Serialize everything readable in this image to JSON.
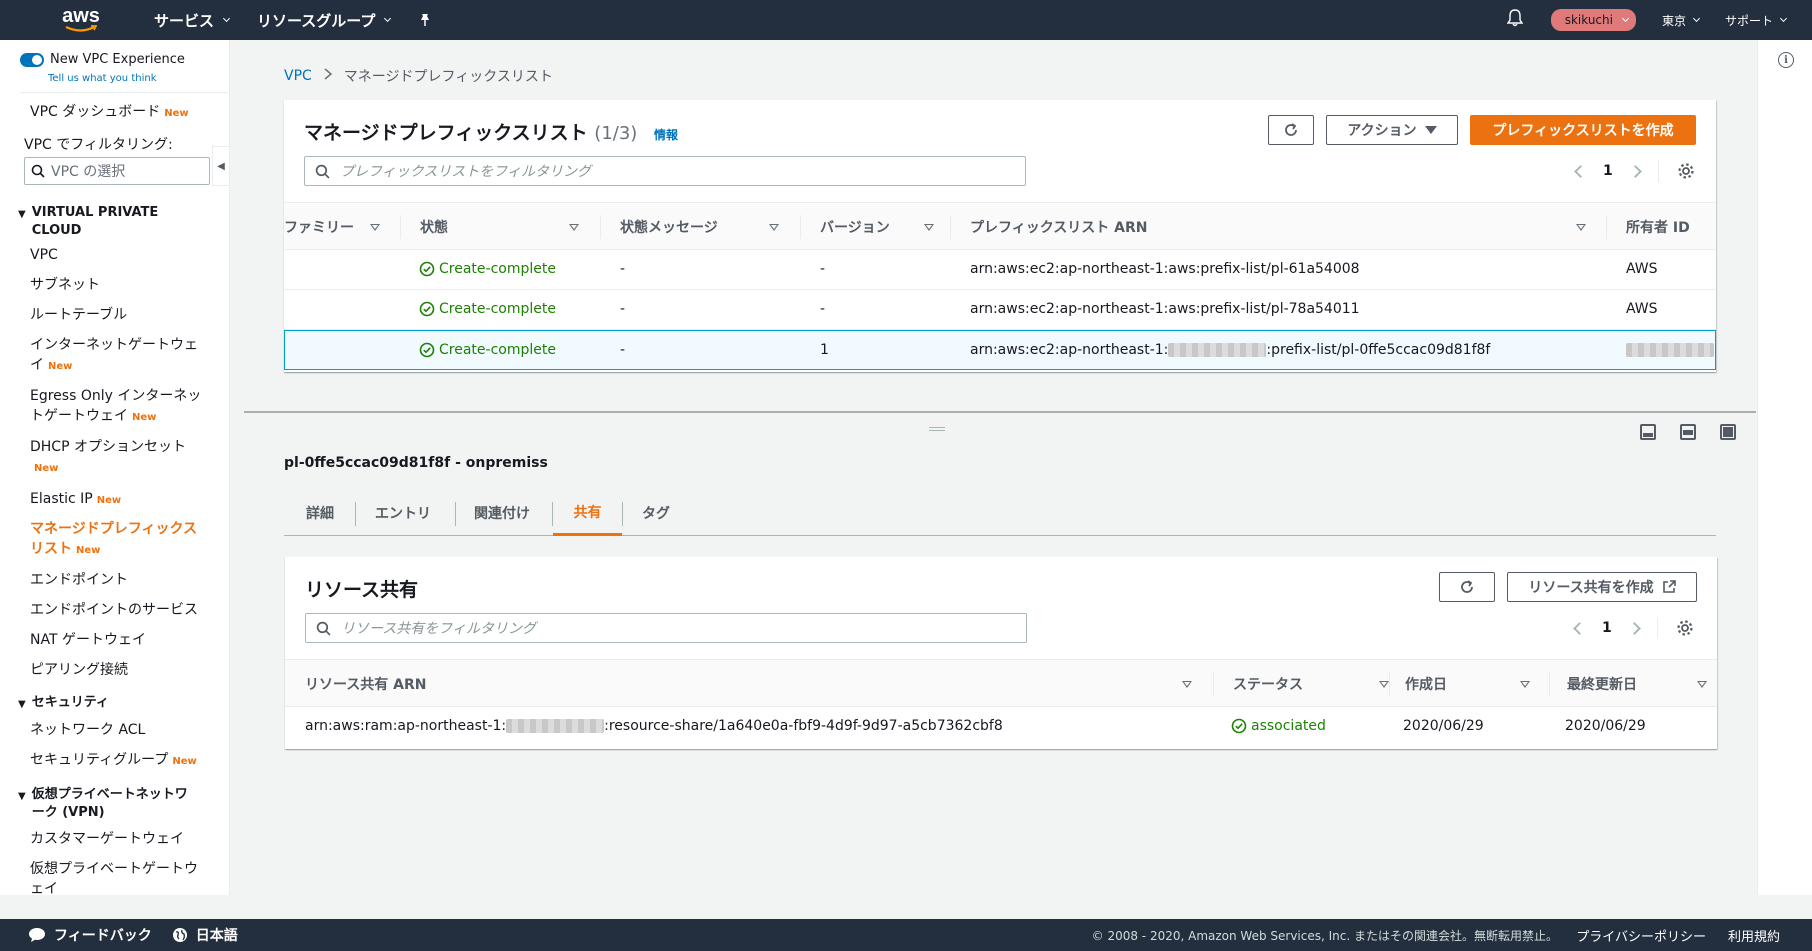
{
  "topnav": {
    "logo_text": "aws",
    "services": "サービス",
    "resource_groups": "リソースグループ",
    "user": "skikuchi",
    "region": "東京",
    "support": "サポート"
  },
  "sidebar": {
    "new_experience": "New VPC Experience",
    "feedback_link": "Tell us what you think",
    "dashboard": "VPC ダッシュボード",
    "new_badge": "New",
    "filter_label": "VPC でフィルタリング:",
    "filter_placeholder": "VPC の選択",
    "section_vpc": "VIRTUAL PRIVATE CLOUD",
    "items": [
      {
        "label": "VPC"
      },
      {
        "label": "サブネット"
      },
      {
        "label": "ルートテーブル"
      },
      {
        "label": "インターネットゲートウェイ"
      },
      {
        "label": "Egress Only インターネットゲートウェイ"
      },
      {
        "label": "DHCP オプションセット"
      },
      {
        "label": "Elastic IP"
      },
      {
        "label": "マネージドプレフィックスリスト"
      },
      {
        "label": "エンドポイント"
      },
      {
        "label": "エンドポイントのサービス"
      },
      {
        "label": "NAT ゲートウェイ"
      },
      {
        "label": "ピアリング接続"
      }
    ],
    "section_security": "セキュリティ",
    "security_items": [
      {
        "label": "ネットワーク ACL"
      },
      {
        "label": "セキュリティグループ"
      }
    ],
    "section_vpn": "仮想プライベートネットワーク (VPN)",
    "vpn_items": [
      {
        "label": "カスタマーゲートウェイ"
      },
      {
        "label": "仮想プライベートゲートウェイ"
      }
    ]
  },
  "breadcrumb": {
    "root": "VPC",
    "current": "マネージドプレフィックスリスト"
  },
  "prefix_panel": {
    "title": "マネージドプレフィックスリスト",
    "count": "(1/3)",
    "info": "情報",
    "actions_label": "アクション",
    "create_label": "プレフィックスリストを作成",
    "filter_placeholder": "プレフィックスリストをフィルタリング",
    "page": "1",
    "columns": [
      "ファミリー",
      "状態",
      "状態メッセージ",
      "バージョン",
      "プレフィックスリスト ARN",
      "所有者 ID"
    ],
    "rows": [
      {
        "state": "Create-complete",
        "message": "-",
        "version": "-",
        "arn": "arn:aws:ec2:ap-northeast-1:aws:prefix-list/pl-61a54008",
        "owner": "AWS"
      },
      {
        "state": "Create-complete",
        "message": "-",
        "version": "-",
        "arn": "arn:aws:ec2:ap-northeast-1:aws:prefix-list/pl-78a54011",
        "owner": "AWS"
      },
      {
        "state": "Create-complete",
        "message": "-",
        "version": "1",
        "arn_prefix": "arn:aws:ec2:ap-northeast-1:",
        "arn_suffix": ":prefix-list/pl-0ffe5ccac09d81f8f",
        "owner": ""
      }
    ]
  },
  "detail": {
    "title": "pl-0ffe5ccac09d81f8f - onpremiss",
    "tabs": [
      "詳細",
      "エントリ",
      "関連付け",
      "共有",
      "タグ"
    ],
    "active_tab": "共有"
  },
  "share_panel": {
    "title": "リソース共有",
    "create_label": "リソース共有を作成",
    "filter_placeholder": "リソース共有をフィルタリング",
    "page": "1",
    "columns": [
      "リソース共有 ARN",
      "ステータス",
      "作成日",
      "最終更新日"
    ],
    "rows": [
      {
        "arn_prefix": "arn:aws:ram:ap-northeast-1:",
        "arn_suffix": ":resource-share/1a640e0a-fbf9-4d9f-9d97-a5cb7362cbf8",
        "status": "associated",
        "created": "2020/06/29",
        "updated": "2020/06/29"
      }
    ]
  },
  "footer": {
    "feedback": "フィードバック",
    "language": "日本語",
    "copyright": "© 2008 - 2020, Amazon Web Services, Inc. またはその関連会社。無断転用禁止。",
    "privacy": "プライバシーポリシー",
    "terms": "利用規約"
  },
  "colors": {
    "nav_bg": "#232f3e",
    "accent": "#ec7211",
    "link": "#0073bb",
    "success": "#1d8102"
  }
}
